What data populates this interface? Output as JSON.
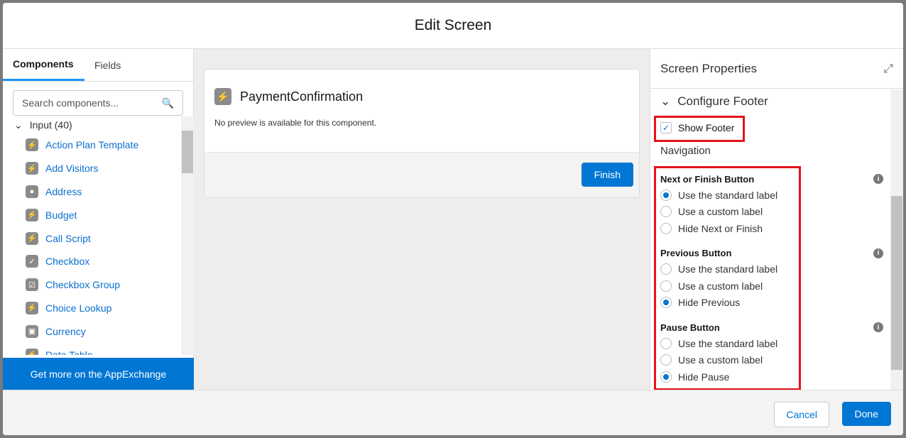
{
  "title": "Edit Screen",
  "left": {
    "tabs": [
      "Components",
      "Fields"
    ],
    "search_placeholder": "Search components...",
    "group": "Input (40)",
    "items": [
      {
        "label": "Action Plan Template",
        "icon": "⚡"
      },
      {
        "label": "Add Visitors",
        "icon": "⚡"
      },
      {
        "label": "Address",
        "icon": "●"
      },
      {
        "label": "Budget",
        "icon": "⚡"
      },
      {
        "label": "Call Script",
        "icon": "⚡"
      },
      {
        "label": "Checkbox",
        "icon": "✓"
      },
      {
        "label": "Checkbox Group",
        "icon": "☑"
      },
      {
        "label": "Choice Lookup",
        "icon": "⚡"
      },
      {
        "label": "Currency",
        "icon": "▣"
      },
      {
        "label": "Data Table",
        "icon": "⚡"
      }
    ],
    "appexchange": "Get more on the AppExchange"
  },
  "canvas": {
    "component": "PaymentConfirmation",
    "desc": "No preview is available for this component.",
    "finish": "Finish"
  },
  "right": {
    "title": "Screen Properties",
    "section": "Configure Footer",
    "show_footer": "Show Footer",
    "navigation": "Navigation",
    "groups": [
      {
        "title": "Next or Finish Button",
        "options": [
          "Use the standard label",
          "Use a custom label",
          "Hide Next or Finish"
        ],
        "selected": 0
      },
      {
        "title": "Previous Button",
        "options": [
          "Use the standard label",
          "Use a custom label",
          "Hide Previous"
        ],
        "selected": 2
      },
      {
        "title": "Pause Button",
        "options": [
          "Use the standard label",
          "Use a custom label",
          "Hide Pause"
        ],
        "selected": 2
      }
    ]
  },
  "footer": {
    "cancel": "Cancel",
    "done": "Done"
  }
}
